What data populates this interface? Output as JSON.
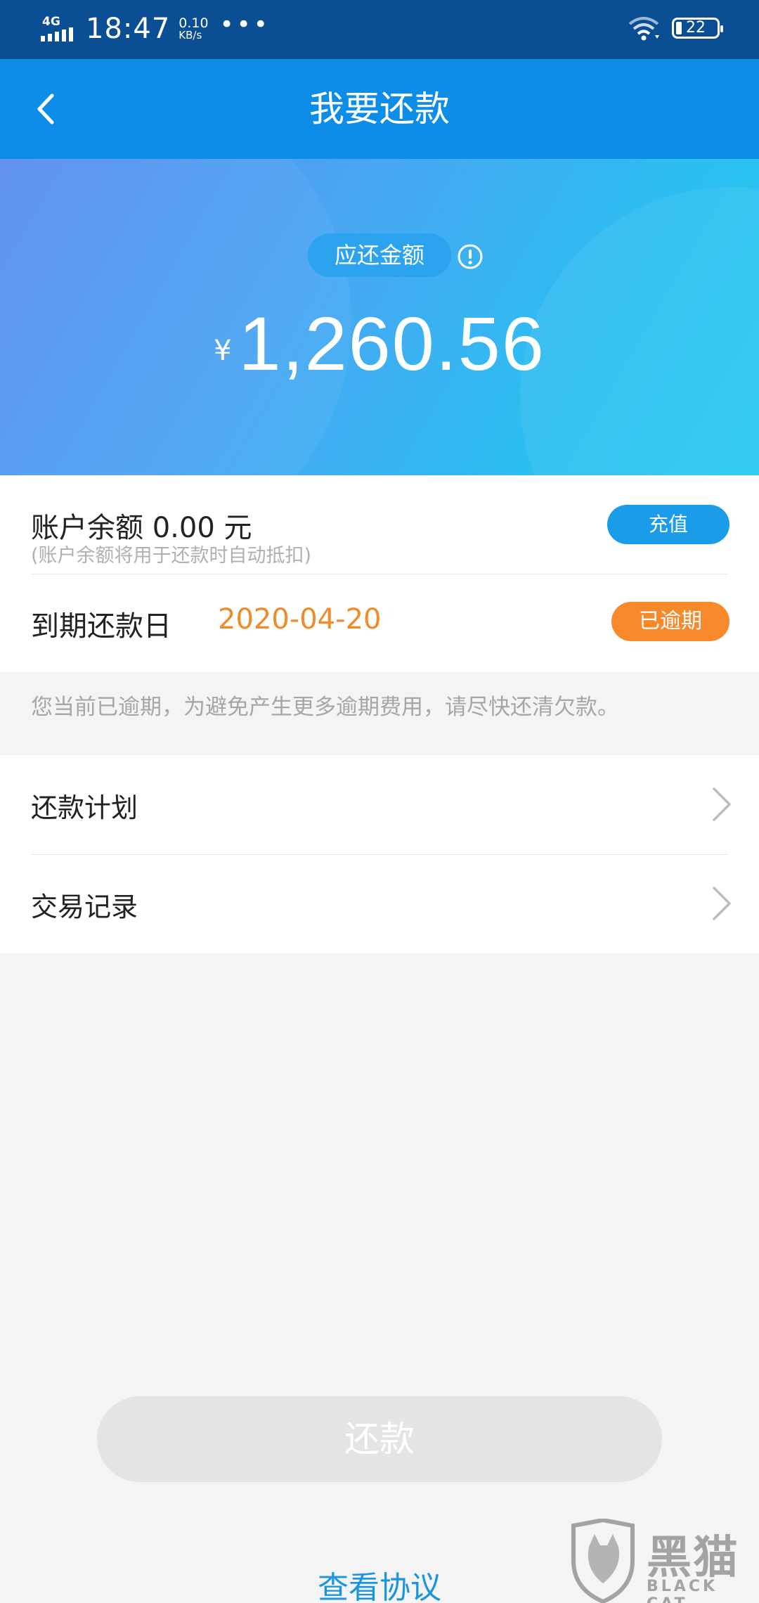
{
  "status_bar": {
    "network": "4G",
    "time": "18:47",
    "speed_value": "0.10",
    "speed_unit": "KB/s",
    "more": "•••",
    "battery": "22"
  },
  "nav": {
    "title": "我要还款"
  },
  "hero": {
    "amount_label": "应还金额",
    "currency": "¥",
    "amount": "1,260.56"
  },
  "account": {
    "balance_label": "账户余额 0.00  元",
    "balance_hint": "(账户余额将用于还款时自动抵扣)",
    "recharge_label": "充值",
    "due_label": "到期还款日",
    "due_date": "2020-04-20",
    "overdue_label": "已逾期",
    "overdue_color": "#f7892b"
  },
  "notice": "您当前已逾期，为避免产生更多逾期费用，请尽快还清欠款。",
  "menu": {
    "items": [
      {
        "label": "还款计划"
      },
      {
        "label": "交易记录"
      }
    ]
  },
  "actions": {
    "repay_label": "还款",
    "agreement_label": "查看协议"
  },
  "watermark": {
    "cn": "黑猫",
    "en": "BLACK CAT"
  },
  "colors": {
    "primary": "#0d8de8",
    "status_bar": "#0a4f93",
    "accent_orange": "#f08b2a"
  }
}
